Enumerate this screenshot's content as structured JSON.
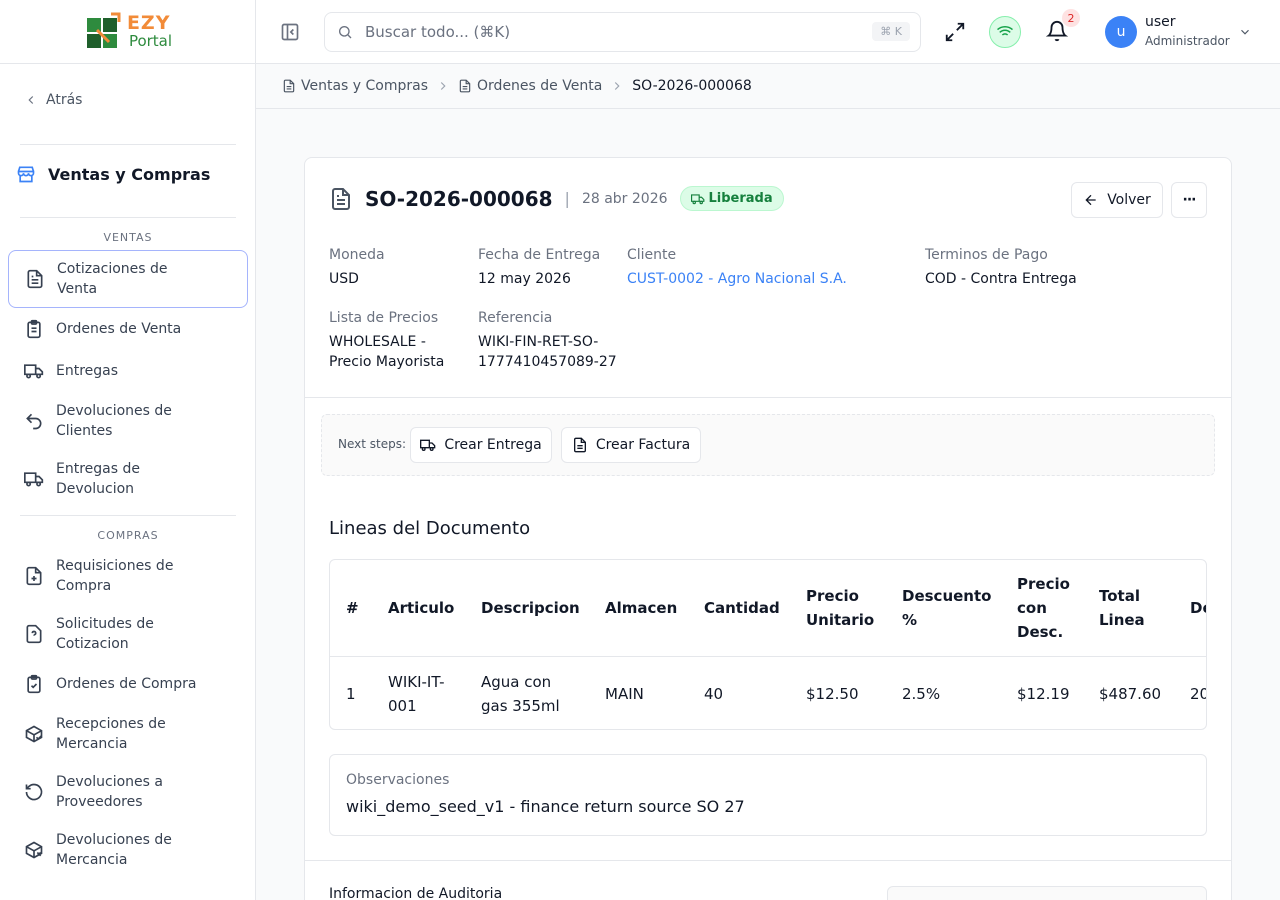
{
  "brand": {
    "line1": "EZY",
    "line2": "Portal"
  },
  "sidebar": {
    "back_label": "Atrás",
    "section_title": "Ventas y Compras",
    "groups": {
      "ventas": "VENTAS",
      "compras": "COMPRAS"
    },
    "items": [
      {
        "label": "Cotizaciones de Venta",
        "icon": "file-text-icon",
        "active": true
      },
      {
        "label": "Ordenes de Venta",
        "icon": "clipboard-list-icon"
      },
      {
        "label": "Entregas",
        "icon": "truck-icon"
      },
      {
        "label": "Devoluciones de Clientes",
        "icon": "undo-icon"
      },
      {
        "label": "Entregas de Devolucion",
        "icon": "truck-icon"
      },
      {
        "label": "Requisiciones de Compra",
        "icon": "file-plus-icon"
      },
      {
        "label": "Solicitudes de Cotizacion",
        "icon": "file-question-icon"
      },
      {
        "label": "Ordenes de Compra",
        "icon": "clipboard-check-icon"
      },
      {
        "label": "Recepciones de Mercancia",
        "icon": "package-check-icon"
      },
      {
        "label": "Devoluciones a Proveedores",
        "icon": "rotate-ccw-icon"
      },
      {
        "label": "Devoluciones de Mercancia",
        "icon": "package-x-icon"
      }
    ]
  },
  "topbar": {
    "search_placeholder": "Buscar todo... (⌘K)",
    "search_shortcut": "⌘ K",
    "notifications_count": "2",
    "user": {
      "initial": "u",
      "name": "user",
      "role": "Administrador"
    }
  },
  "breadcrumb": [
    "Ventas y Compras",
    "Ordenes de Venta",
    "SO-2026-000068"
  ],
  "document": {
    "id": "SO-2026-000068",
    "date": "28 abr 2026",
    "status": "Liberada",
    "back_button": "Volver",
    "more_button": "···",
    "fields": {
      "moneda": {
        "label": "Moneda",
        "value": "USD"
      },
      "fecha_entrega": {
        "label": "Fecha de Entrega",
        "value": "12 may 2026"
      },
      "cliente": {
        "label": "Cliente",
        "value": "CUST-0002 - Agro Nacional S.A."
      },
      "terminos": {
        "label": "Terminos de Pago",
        "value": "COD - Contra Entrega"
      },
      "lista_precios": {
        "label": "Lista de Precios",
        "value_line1": "WHOLESALE -",
        "value_line2": "Precio Mayorista"
      },
      "referencia": {
        "label": "Referencia",
        "value_line1": "WIKI-FIN-RET-SO-",
        "value_line2": "1777410457089-27"
      }
    },
    "next_steps": {
      "label": "Next steps:",
      "crear_entrega": "Crear Entrega",
      "crear_factura": "Crear Factura"
    },
    "lines": {
      "title": "Lineas del Documento",
      "headers": {
        "num": "#",
        "articulo": "Articulo",
        "descripcion": "Descripcion",
        "almacen": "Almacen",
        "cantidad": "Cantidad",
        "precio_unitario_1": "Precio",
        "precio_unitario_2": "Unitario",
        "descuento_1": "Descuento",
        "descuento_2": "%",
        "precio_desc_1": "Precio",
        "precio_desc_2": "con",
        "precio_desc_3": "Desc.",
        "total_1": "Total",
        "total_2": "Linea",
        "extra": "De"
      },
      "rows": [
        {
          "num": "1",
          "articulo_1": "WIKI-IT-",
          "articulo_2": "001",
          "descripcion_1": "Agua con",
          "descripcion_2": "gas 355ml",
          "almacen": "MAIN",
          "cantidad": "40",
          "precio_unitario": "$12.50",
          "descuento": "2.5%",
          "precio_desc": "$12.19",
          "total": "$487.60",
          "extra": "20"
        }
      ]
    },
    "observaciones": {
      "label": "Observaciones",
      "value": "wiki_demo_seed_v1 - finance return source SO 27"
    },
    "audit_title": "Informacion de Auditoria"
  },
  "colors": {
    "accent": "#3b82f6",
    "status_green": "#15803d",
    "logo_orange": "#f28b38",
    "logo_green": "#2e8b3e"
  }
}
